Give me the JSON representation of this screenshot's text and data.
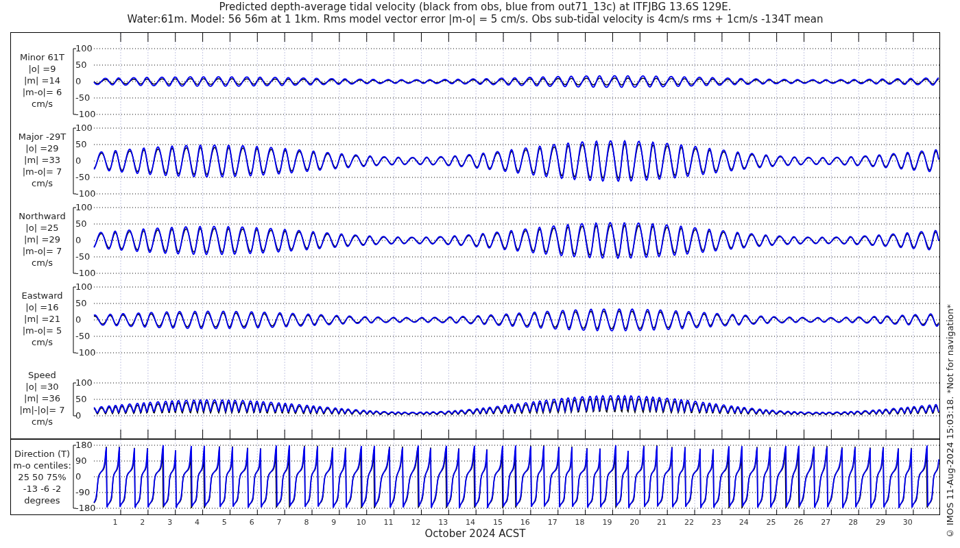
{
  "title": [
    "Predicted depth-average tidal velocity (black from obs, blue from out71_13c) at ITFJBG 13.6S 129E.",
    "Water:61m. Model: 56 56m at 1 1km. Rms model vector error |m-o| = 5 cm/s. Obs sub-tidal velocity is 4cm/s rms + 1cm/s -134T mean"
  ],
  "upper_panels": [
    {
      "kind": "minor",
      "label_lines": [
        "Minor 61T",
        "|o| =9",
        "|m| =14",
        "|m-o|= 6",
        "cm/s"
      ],
      "yticks": [
        "100",
        "50",
        "0",
        "-50",
        "-100"
      ]
    },
    {
      "kind": "major",
      "label_lines": [
        "Major -29T",
        "|o| =29",
        "|m| =33",
        "|m-o|= 7",
        "cm/s"
      ],
      "yticks": [
        "100",
        "50",
        "0",
        "-50",
        "-100"
      ]
    },
    {
      "kind": "northward",
      "label_lines": [
        "Northward",
        "|o| =25",
        "|m| =29",
        "|m-o|= 7",
        "cm/s"
      ],
      "yticks": [
        "100",
        "50",
        "0",
        "-50",
        "-100"
      ]
    },
    {
      "kind": "eastward",
      "label_lines": [
        "Eastward",
        "|o| =16",
        "|m| =21",
        "|m-o|= 5",
        "cm/s"
      ],
      "yticks": [
        "100",
        "50",
        "0",
        "-50",
        "-100"
      ]
    },
    {
      "kind": "speed",
      "label_lines": [
        "Speed",
        "|o| =30",
        "|m| =36",
        "|m|-|o|= 7",
        "cm/s"
      ],
      "yticks": [
        "100",
        "50",
        "0"
      ]
    }
  ],
  "lower_panel": {
    "kind": "direction",
    "label_lines": [
      "Direction (T)",
      "m-o centiles:",
      "25  50  75%",
      "-13  -6  -2",
      "degrees"
    ],
    "yticks": [
      "180",
      "90",
      "0",
      "-90",
      "-180"
    ]
  },
  "x_tick_labels": [
    "1",
    "2",
    "3",
    "4",
    "5",
    "6",
    "7",
    "8",
    "9",
    "10",
    "11",
    "12",
    "13",
    "14",
    "15",
    "16",
    "17",
    "18",
    "19",
    "20",
    "21",
    "22",
    "23",
    "24",
    "25",
    "26",
    "27",
    "28",
    "29",
    "30"
  ],
  "xlabel": "October 2024 ACST",
  "side_note": "© IMOS 11-Aug-2024 15:03:18. *Not for navigation*"
}
